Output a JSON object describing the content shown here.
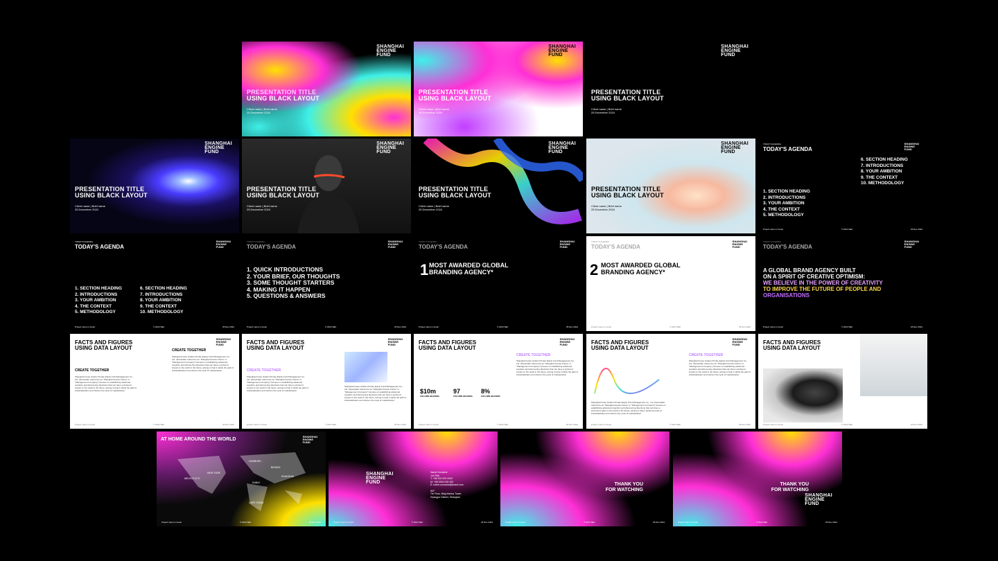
{
  "brand": {
    "logo_lines": [
      "SHANGHAI",
      "ENGINE",
      "FUND"
    ]
  },
  "cover": {
    "title_line1": "PRESENTATION TITLE",
    "title_line2": "USING BLACK LAYOUT",
    "client": "Client name | Brief name",
    "date": "25 December 2024"
  },
  "agenda": {
    "kicker": "TODAY'S AGENDA",
    "heading": "TODAY'S AGENDA",
    "items_a": [
      "1. SECTION HEADING",
      "2. INTRODUCTIONS",
      "3. YOUR AMBITION",
      "4. THE CONTEXT",
      "5. METHODOLOGY"
    ],
    "items_b": [
      "6. SECTION HEADING",
      "7. INTRODUCTIONS",
      "8. YOUR AMBITION",
      "9. THE CONTEXT",
      "10. METHODOLOGY"
    ],
    "items_c": [
      "1. QUICK INTRODUCTIONS",
      "2. YOUR BRIEF, OUR THOUGHTS",
      "3. SOME THOUGHT STARTERS",
      "4. MAKING IT HAPPEN",
      "5. QUESTIONS & ANSWERS"
    ]
  },
  "awards": {
    "num1": "1",
    "num2": "2",
    "line1": "MOST AWARDED GLOBAL",
    "line2": "BRANDING AGENCY*"
  },
  "agency": {
    "line1": "A GLOBAL BRAND AGENCY BUILT",
    "line2": "ON A SPIRIT OF CREATIVE OPTIMISM:",
    "line3": "WE BELIEVE IN THE POWER OF CREATIVITY",
    "line4": "TO IMPROVE THE FUTURE OF PEOPLE AND",
    "line5": "ORGANISATIONS"
  },
  "facts": {
    "title_line1": "FACTS AND FIGURES",
    "title_line2": "USING DATA LAYOUT",
    "create": "CREATE TOGETHER",
    "body": "Shanghai Future Golden Private Equity Fund Management Co., Ltd. (hereinafter referred to as \"Shanghai Guotou Future\" or \"Management Company\") focuses on establishing advanced cognition and discovering directions that can have a profound impact on the world in the future, aiming to help it clarify the path of industrialization and shorten the cycle of marketization.",
    "stats": [
      {
        "value": "$10m",
        "label": "COLUMN HEADING"
      },
      {
        "value": "97",
        "label": "COLUMN HEADING"
      },
      {
        "value": "8%",
        "label": "COLUMN HEADING"
      }
    ]
  },
  "world": {
    "title": "AT HOME AROUND THE WORLD",
    "cities": [
      "HAMBURG",
      "BEIJING",
      "NEW YORK",
      "SHANGHAI",
      "MEXICO CITY",
      "DUBAI",
      "CAPE TOWN"
    ]
  },
  "contact": {
    "name": "Name Surname",
    "job": "Job Title",
    "tel": "T: +86 000 000 0000",
    "mob": "M: +86 0000 000 000",
    "email": "E: name.surname@brand.com",
    "address1": "8XF",
    "address2": "7th Floor, Bldg Marina Tower,",
    "address3": "Huangpu District, Shanghai"
  },
  "thanks": {
    "line1": "THANK YOU",
    "line2": "FOR WATCHING"
  },
  "footer": {
    "left": "Project name in footer",
    "mid": "© 2024 SEF",
    "right": "25 Dec 2024"
  },
  "colors": {
    "pink": "#ff2fd6",
    "yellow": "#ffe000",
    "cyan": "#3ef0e8",
    "purple": "#8a4bff"
  }
}
